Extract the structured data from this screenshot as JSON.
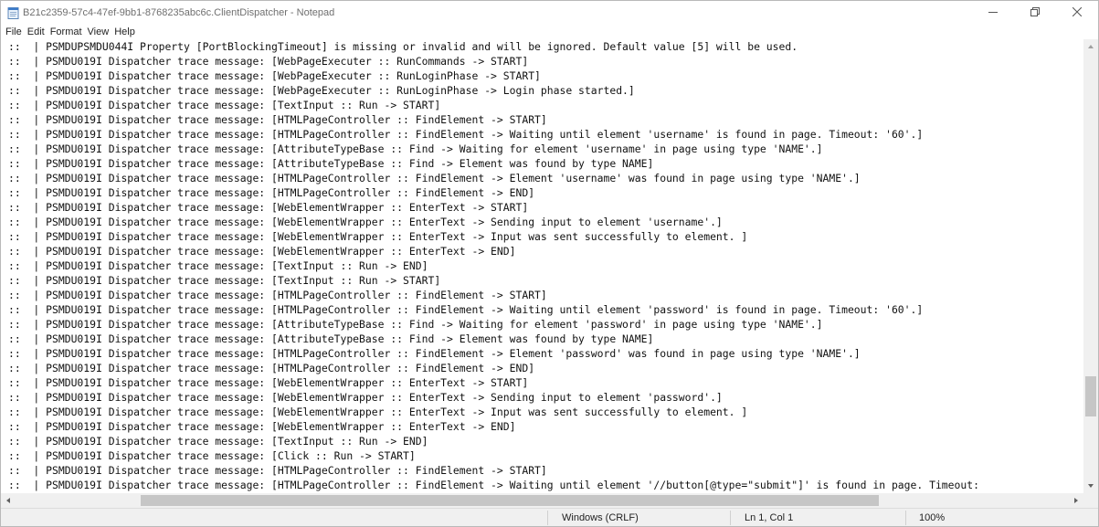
{
  "window": {
    "title": "B21c2359-57c4-47ef-9bb1-8768235abc6c.ClientDispatcher - Notepad"
  },
  "icons": {
    "app": "notepad-icon",
    "minimize": "minimize-icon",
    "maximize": "restore-icon",
    "close": "close-icon"
  },
  "menu": {
    "items": [
      "File",
      "Edit",
      "Format",
      "View",
      "Help"
    ]
  },
  "editor": {
    "lines": [
      "::  | PSMDUPSMDU044I Property [PortBlockingTimeout] is missing or invalid and will be ignored. Default value [5] will be used.",
      "::  | PSMDU019I Dispatcher trace message: [WebPageExecuter :: RunCommands -> START]",
      "::  | PSMDU019I Dispatcher trace message: [WebPageExecuter :: RunLoginPhase -> START]",
      "::  | PSMDU019I Dispatcher trace message: [WebPageExecuter :: RunLoginPhase -> Login phase started.]",
      "::  | PSMDU019I Dispatcher trace message: [TextInput :: Run -> START]",
      "::  | PSMDU019I Dispatcher trace message: [HTMLPageController :: FindElement -> START]",
      "::  | PSMDU019I Dispatcher trace message: [HTMLPageController :: FindElement -> Waiting until element 'username' is found in page. Timeout: '60'.]",
      "::  | PSMDU019I Dispatcher trace message: [AttributeTypeBase :: Find -> Waiting for element 'username' in page using type 'NAME'.]",
      "::  | PSMDU019I Dispatcher trace message: [AttributeTypeBase :: Find -> Element was found by type NAME]",
      "::  | PSMDU019I Dispatcher trace message: [HTMLPageController :: FindElement -> Element 'username' was found in page using type 'NAME'.]",
      "::  | PSMDU019I Dispatcher trace message: [HTMLPageController :: FindElement -> END]",
      "::  | PSMDU019I Dispatcher trace message: [WebElementWrapper :: EnterText -> START]",
      "::  | PSMDU019I Dispatcher trace message: [WebElementWrapper :: EnterText -> Sending input to element 'username'.]",
      "::  | PSMDU019I Dispatcher trace message: [WebElementWrapper :: EnterText -> Input was sent successfully to element. ]",
      "::  | PSMDU019I Dispatcher trace message: [WebElementWrapper :: EnterText -> END]",
      "::  | PSMDU019I Dispatcher trace message: [TextInput :: Run -> END]",
      "::  | PSMDU019I Dispatcher trace message: [TextInput :: Run -> START]",
      "::  | PSMDU019I Dispatcher trace message: [HTMLPageController :: FindElement -> START]",
      "::  | PSMDU019I Dispatcher trace message: [HTMLPageController :: FindElement -> Waiting until element 'password' is found in page. Timeout: '60'.]",
      "::  | PSMDU019I Dispatcher trace message: [AttributeTypeBase :: Find -> Waiting for element 'password' in page using type 'NAME'.]",
      "::  | PSMDU019I Dispatcher trace message: [AttributeTypeBase :: Find -> Element was found by type NAME]",
      "::  | PSMDU019I Dispatcher trace message: [HTMLPageController :: FindElement -> Element 'password' was found in page using type 'NAME'.]",
      "::  | PSMDU019I Dispatcher trace message: [HTMLPageController :: FindElement -> END]",
      "::  | PSMDU019I Dispatcher trace message: [WebElementWrapper :: EnterText -> START]",
      "::  | PSMDU019I Dispatcher trace message: [WebElementWrapper :: EnterText -> Sending input to element 'password'.]",
      "::  | PSMDU019I Dispatcher trace message: [WebElementWrapper :: EnterText -> Input was sent successfully to element. ]",
      "::  | PSMDU019I Dispatcher trace message: [WebElementWrapper :: EnterText -> END]",
      "::  | PSMDU019I Dispatcher trace message: [TextInput :: Run -> END]",
      "::  | PSMDU019I Dispatcher trace message: [Click :: Run -> START]",
      "::  | PSMDU019I Dispatcher trace message: [HTMLPageController :: FindElement -> START]",
      "::  | PSMDU019I Dispatcher trace message: [HTMLPageController :: FindElement -> Waiting until element '//button[@type=\"submit\"]' is found in page. Timeout:"
    ]
  },
  "status": {
    "line_ending": "Windows (CRLF)",
    "position": "Ln 1, Col 1",
    "zoom": "100%"
  }
}
